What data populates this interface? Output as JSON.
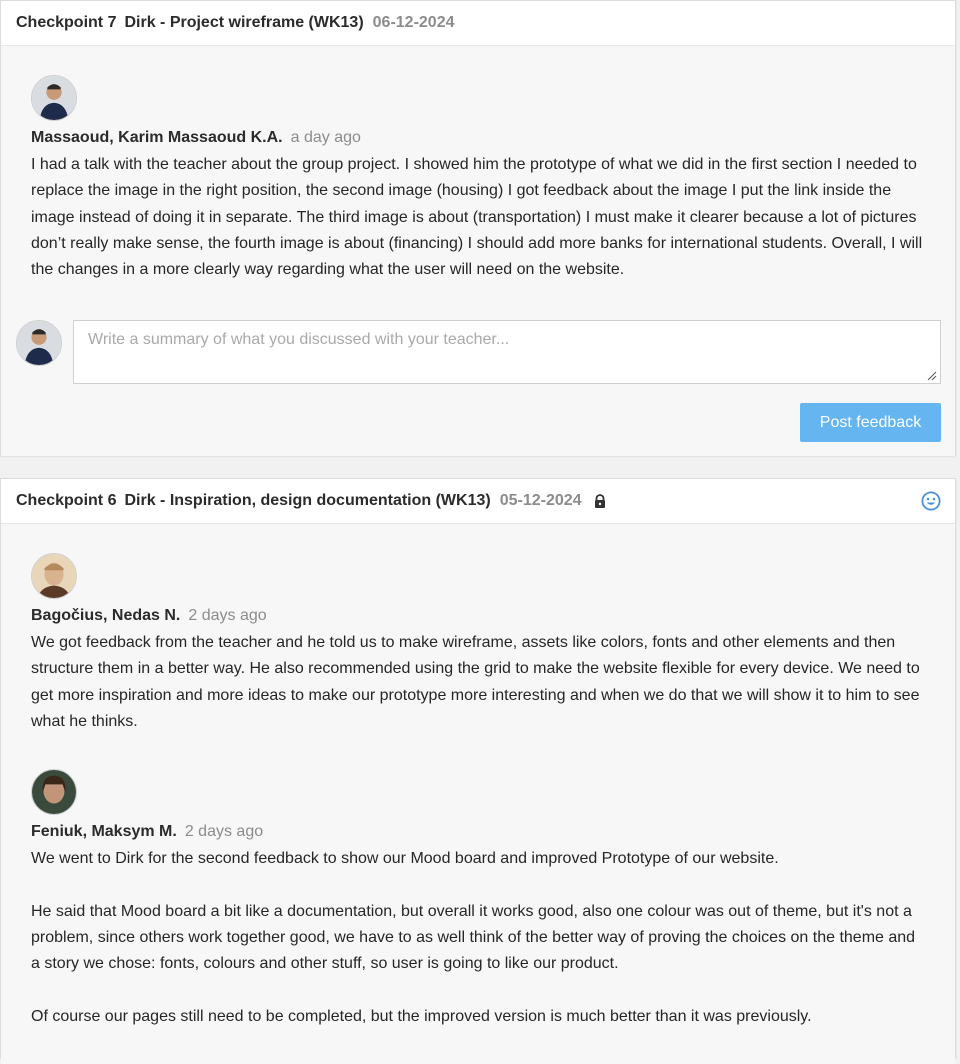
{
  "checkpoint7": {
    "label": "Checkpoint 7",
    "title": "Dirk - Project wireframe (WK13)",
    "date": "06-12-2024",
    "comments": [
      {
        "author": "Massaoud, Karim Massaoud K.A.",
        "time": "a day ago",
        "text": "I had a talk with the teacher about the group project. I showed him the prototype of what we did in the first section I needed to replace the image in the right position, the second image (housing) I got feedback about the image I put the link inside the image instead of doing it in separate. The third image is about (transportation) I must make it clearer because a lot of pictures don’t really make sense, the fourth image is about (financing) I should add more banks for international students. Overall, I will the changes in a more clearly way regarding what the user will need on the website."
      }
    ],
    "reply_placeholder": "Write a summary of what you discussed with your teacher...",
    "post_button": "Post feedback"
  },
  "checkpoint6": {
    "label": "Checkpoint 6",
    "title": "Dirk - Inspiration, design documentation (WK13)",
    "date": "05-12-2024",
    "icons": [
      "lock-icon",
      "smiley-icon"
    ],
    "comments": [
      {
        "author": "Bagočius, Nedas N.",
        "time": "2 days ago",
        "text": "We got feedback from the teacher and he told us to make wireframe, assets like colors, fonts and other elements and then structure them in a better way. He also recommended using the grid to make the website flexible for every device. We need to get more inspiration and more ideas to make our prototype more interesting and when we do that we will show it to him to see what he thinks."
      },
      {
        "author": "Feniuk, Maksym M.",
        "time": "2 days ago",
        "text": "We went to Dirk for the second feedback to show our Mood board and improved Prototype of our website.\n\nHe said that Mood board a bit like a documentation, but overall it works good, also one colour was out of theme, but it's not a problem, since others work together good, we have to as well think of the better way of proving the choices on the theme and a story we chose: fonts, colours and other stuff, so user is going to like our product.\n\nOf course our pages still need to be completed, but the improved version is much better than it was previously."
      }
    ]
  },
  "colors": {
    "accent_button": "#64b5f0",
    "smiley": "#4a90d9"
  }
}
